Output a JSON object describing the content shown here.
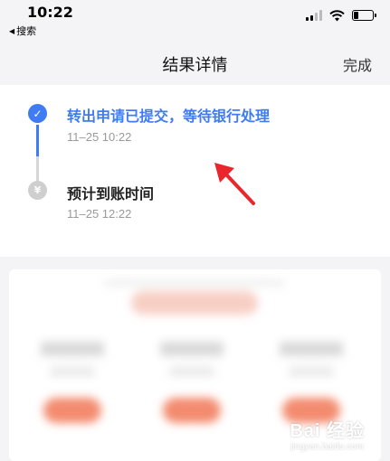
{
  "status_bar": {
    "time": "10:22",
    "back_app": "搜索",
    "battery_level": 0.25
  },
  "nav": {
    "title": "结果详情",
    "done_label": "完成"
  },
  "timeline": {
    "steps": [
      {
        "title": "转出申请已提交，等待银行处理",
        "time": "11–25 10:22",
        "status": "done",
        "color": "#3f7cf3"
      },
      {
        "title": "预计到账时间",
        "time": "11–25 12:22",
        "status": "pending",
        "icon_glyph": "¥"
      }
    ]
  },
  "watermark": {
    "main": "Bai 经验",
    "sub": "jingyan.baidu.com"
  }
}
